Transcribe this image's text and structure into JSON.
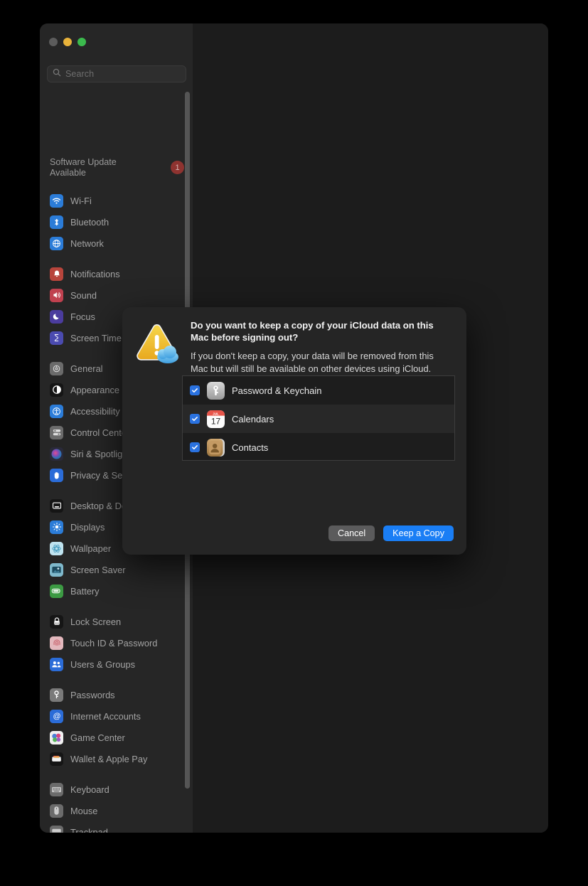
{
  "window": {
    "traffic_lights": [
      "close",
      "minimize",
      "maximize"
    ],
    "search": {
      "placeholder": "Search",
      "value": ""
    }
  },
  "sidebar": {
    "update": {
      "label": "Software Update Available",
      "badge": "1"
    },
    "groups": [
      {
        "items": [
          {
            "label": "Wi-Fi",
            "icon": "wifi-icon",
            "color": "#2b7cd8"
          },
          {
            "label": "Bluetooth",
            "icon": "bluetooth-icon",
            "color": "#2b7cd8"
          },
          {
            "label": "Network",
            "icon": "globe-icon",
            "color": "#2b7cd8"
          }
        ]
      },
      {
        "items": [
          {
            "label": "Notifications",
            "icon": "bell-icon",
            "color": "#b8453c"
          },
          {
            "label": "Sound",
            "icon": "speaker-icon",
            "color": "#c0414f"
          },
          {
            "label": "Focus",
            "icon": "moon-icon",
            "color": "#4b3c9e"
          },
          {
            "label": "Screen Time",
            "icon": "hourglass-icon",
            "color": "#4b4bb0"
          }
        ]
      },
      {
        "items": [
          {
            "label": "General",
            "icon": "gear-icon",
            "color": "#6b6b6b"
          },
          {
            "label": "Appearance",
            "icon": "contrast-icon",
            "color": "#151515"
          },
          {
            "label": "Accessibility",
            "icon": "accessibility-icon",
            "color": "#2b7cd8"
          },
          {
            "label": "Control Center",
            "icon": "control-center-icon",
            "color": "#6b6b6b"
          },
          {
            "label": "Siri & Spotlight",
            "icon": "siri-icon",
            "color": "#2a2a3a"
          },
          {
            "label": "Privacy & Security",
            "icon": "hand-icon",
            "color": "#2b6cd8"
          }
        ]
      },
      {
        "items": [
          {
            "label": "Desktop & Dock",
            "icon": "desktop-dock-icon",
            "color": "#151515"
          },
          {
            "label": "Displays",
            "icon": "display-icon",
            "color": "#2b7cd8"
          },
          {
            "label": "Wallpaper",
            "icon": "wallpaper-icon",
            "color": "#9fd4e6"
          },
          {
            "label": "Screen Saver",
            "icon": "screen-saver-icon",
            "color": "#7fb9cc"
          },
          {
            "label": "Battery",
            "icon": "battery-icon",
            "color": "#3c9a43"
          }
        ]
      },
      {
        "items": [
          {
            "label": "Lock Screen",
            "icon": "lock-icon",
            "color": "#151515"
          },
          {
            "label": "Touch ID & Password",
            "icon": "fingerprint-icon",
            "color": "#d4757d"
          },
          {
            "label": "Users & Groups",
            "icon": "users-icon",
            "color": "#2b6cd8"
          }
        ]
      },
      {
        "items": [
          {
            "label": "Passwords",
            "icon": "key-icon",
            "color": "#6b6b6b"
          },
          {
            "label": "Internet Accounts",
            "icon": "at-icon",
            "color": "#2b6cd8"
          },
          {
            "label": "Game Center",
            "icon": "balloons-icon",
            "color": "#e0e0e0"
          },
          {
            "label": "Wallet & Apple Pay",
            "icon": "wallet-icon",
            "color": "#151515"
          }
        ]
      },
      {
        "items": [
          {
            "label": "Keyboard",
            "icon": "keyboard-icon",
            "color": "#6b6b6b"
          },
          {
            "label": "Mouse",
            "icon": "mouse-icon",
            "color": "#6b6b6b"
          },
          {
            "label": "Trackpad",
            "icon": "trackpad-icon",
            "color": "#6b6b6b"
          }
        ]
      }
    ]
  },
  "dialog": {
    "alert_icon": "warning-triangle-icloud-icon",
    "title": "Do you want to keep a copy of your iCloud data on this Mac before signing out?",
    "message": "If you don't keep a copy, your data will be removed from this Mac but will still be available on other devices using iCloud.",
    "items": [
      {
        "label": "Password & Keychain",
        "icon": "keychain-icon",
        "checked": true
      },
      {
        "label": "Calendars",
        "icon": "calendar-icon",
        "checked": true
      },
      {
        "label": "Contacts",
        "icon": "contacts-icon",
        "checked": true
      }
    ],
    "calendar_icon": {
      "month": "JUL",
      "day": "17"
    },
    "buttons": {
      "cancel": "Cancel",
      "primary": "Keep a Copy"
    },
    "colors": {
      "primary": "#1a7ef5",
      "cancel": "#5b5b5c",
      "checkbox": "#2a72e0"
    }
  }
}
